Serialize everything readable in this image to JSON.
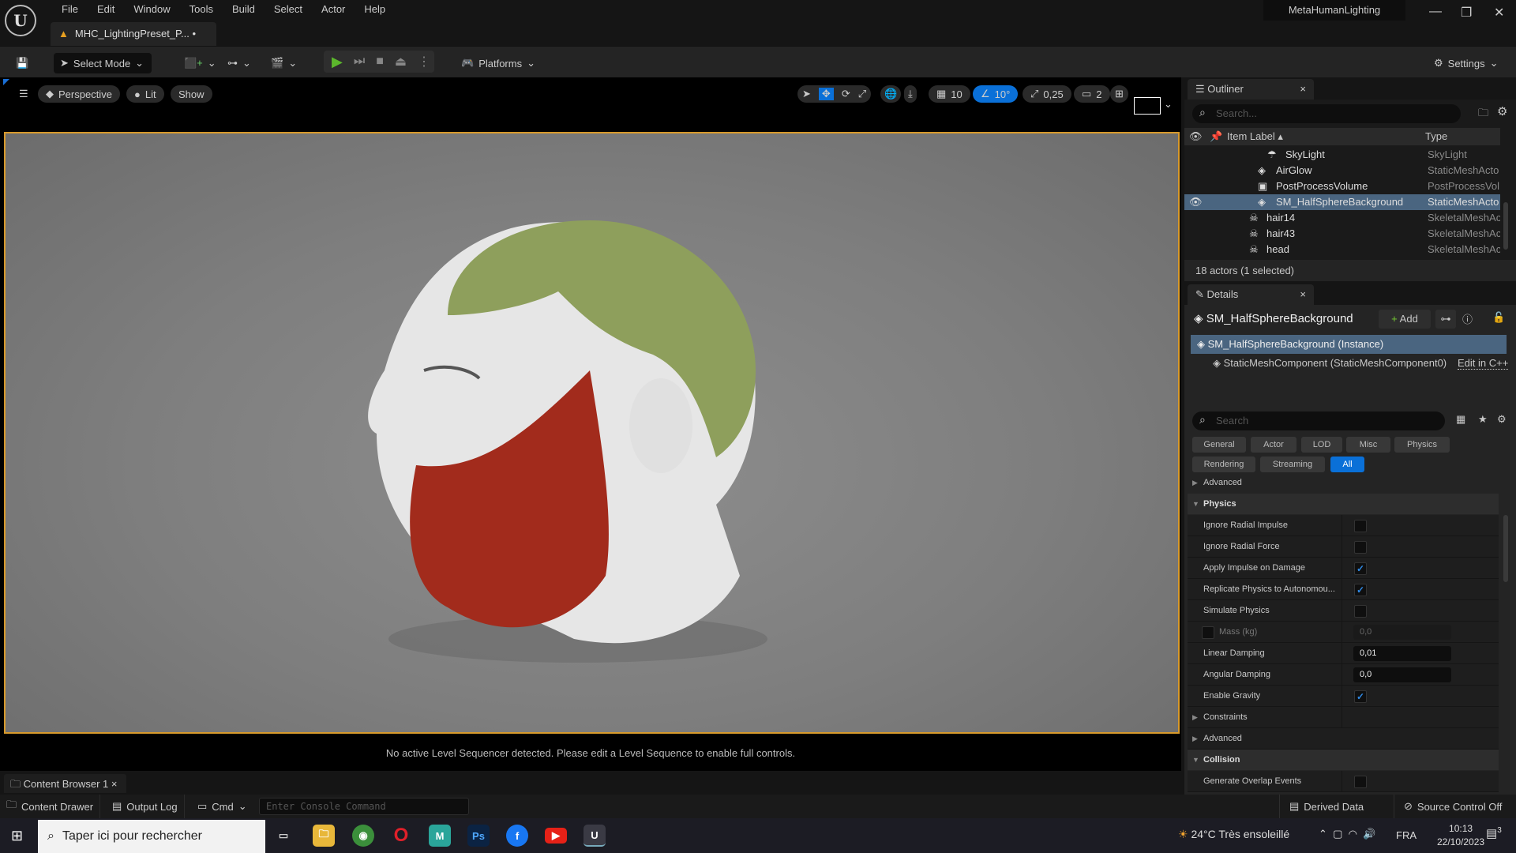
{
  "app": {
    "logo": "U",
    "title": "MetaHumanLighting",
    "document_tab": "MHC_LightingPreset_P...",
    "document_dirty": "•"
  },
  "menu": [
    "File",
    "Edit",
    "Window",
    "Tools",
    "Build",
    "Select",
    "Actor",
    "Help"
  ],
  "toolbar": {
    "select_mode": "Select Mode",
    "platforms": "Platforms",
    "settings": "Settings"
  },
  "viewport": {
    "perspective": "Perspective",
    "lit": "Lit",
    "show": "Show",
    "grid_snap": "10",
    "rotation_snap": "10°",
    "scale_snap": "0,25",
    "camera_speed": "2",
    "sequencer_message": "No active Level Sequencer detected. Please edit a Level Sequence to enable full controls."
  },
  "bottom": {
    "content_browser_tab": "Content Browser 1",
    "content_drawer": "Content Drawer",
    "output_log": "Output Log",
    "cmd": "Cmd",
    "console_placeholder": "Enter Console Command",
    "derived_data": "Derived Data",
    "source_control": "Source Control Off"
  },
  "outliner": {
    "tab": "Outliner",
    "search_placeholder": "Search...",
    "col_label": "Item Label",
    "col_type": "Type",
    "rows": [
      {
        "label": "SkyLight",
        "type": "SkyLight"
      },
      {
        "label": "AirGlow",
        "type": "StaticMeshActo"
      },
      {
        "label": "PostProcessVolume",
        "type": "PostProcessVol"
      },
      {
        "label": "SM_HalfSphereBackground",
        "type": "StaticMeshActo"
      },
      {
        "label": "hair14",
        "type": "SkeletalMeshAc"
      },
      {
        "label": "hair43",
        "type": "SkeletalMeshAc"
      },
      {
        "label": "head",
        "type": "SkeletalMeshAc"
      }
    ],
    "status": "18 actors (1 selected)"
  },
  "details": {
    "tab": "Details",
    "actor_name": "SM_HalfSphereBackground",
    "add": "Add",
    "instance": "SM_HalfSphereBackground (Instance)",
    "component": "StaticMeshComponent (StaticMeshComponent0)",
    "edit_cpp": "Edit in C++",
    "search_placeholder": "Search",
    "filters": [
      "General",
      "Actor",
      "LOD",
      "Misc",
      "Physics",
      "Rendering",
      "Streaming",
      "All"
    ],
    "advanced": "Advanced",
    "physics": {
      "title": "Physics",
      "ignore_radial_impulse": "Ignore Radial Impulse",
      "ignore_radial_force": "Ignore Radial Force",
      "apply_impulse": "Apply Impulse on Damage",
      "replicate": "Replicate Physics to Autonomou...",
      "simulate": "Simulate Physics",
      "mass": "Mass (kg)",
      "mass_value": "0,0",
      "linear_damping": "Linear Damping",
      "linear_value": "0,01",
      "angular_damping": "Angular Damping",
      "angular_value": "0,0",
      "gravity": "Enable Gravity",
      "constraints": "Constraints",
      "advanced": "Advanced"
    },
    "collision": {
      "title": "Collision",
      "overlap": "Generate Overlap Events"
    }
  },
  "taskbar": {
    "search": "Taper ici pour rechercher",
    "weather": "24°C  Très ensoleillé",
    "lang": "FRA",
    "time": "10:13",
    "date": "22/10/2023",
    "notifications": "3"
  },
  "colors": {
    "accent": "#0a70d8",
    "selection": "#4a6580",
    "viewport_border": "#d89a2c",
    "play": "#5cb82c"
  }
}
